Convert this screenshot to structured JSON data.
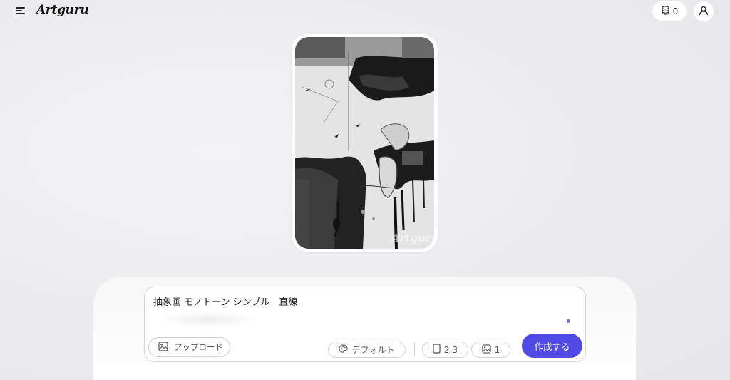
{
  "app": {
    "name": "Artguru",
    "credits": "0"
  },
  "icons": {
    "menu": "menu-icon",
    "credits": "coins-stack-icon",
    "user": "user-icon",
    "upload": "image-icon",
    "style": "palette-icon",
    "ratio": "portrait-frame-icon",
    "count": "image-icon"
  },
  "artwork": {
    "watermark": "Artguru"
  },
  "prompt": {
    "text": "抽象画 モノトーン シンプル　直線"
  },
  "toolbar": {
    "upload_label": "アップロード",
    "style_label": "デフォルト",
    "ratio_label": "2:3",
    "count_label": "1",
    "create_label": "作成する"
  },
  "colors": {
    "accent": "#4f4ae3",
    "dot": "#8a5cf6"
  }
}
